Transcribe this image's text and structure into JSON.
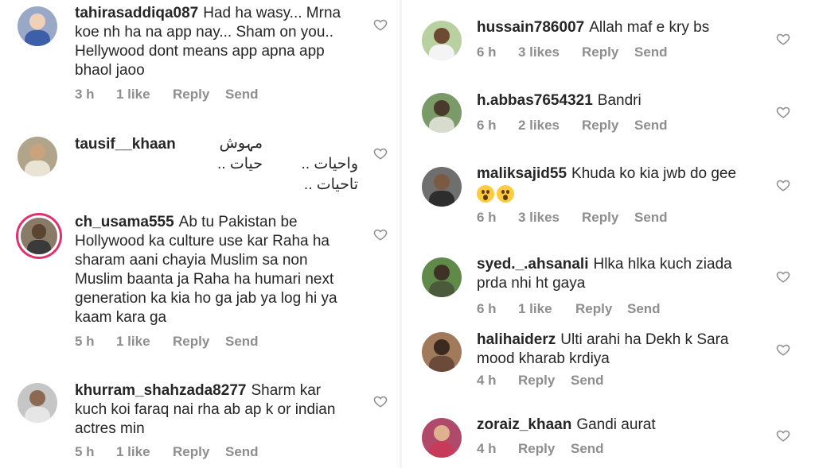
{
  "left": [
    {
      "username": "tahirasaddiqa087",
      "text": "Had ha wasy... Mrna koe nh ha na app nay... Sham on you.. Hellywood dont means app apna app bhaol jaoo",
      "time": "3 h",
      "likes": "1 like",
      "reply": "Reply",
      "send": "Send"
    },
    {
      "username": "tausif__khaan",
      "text_rtl": [
        "مہوش حیات ..",
        "واحیات ..",
        "تاحیات .."
      ]
    },
    {
      "username": "ch_usama555",
      "text": "Ab tu Pakistan be Hollywood ka culture use kar Raha ha sharam aani chayia Muslim sa non Muslim baanta ja Raha ha humari next generation ka kia ho ga jab ya log hi ya kaam kara ga",
      "time": "5 h",
      "likes": "1 like",
      "reply": "Reply",
      "send": "Send"
    },
    {
      "username": "khurram_shahzada8277",
      "text": "Sharm kar kuch koi faraq nai rha ab ap k or indian actres min",
      "time": "5 h",
      "likes": "1 like",
      "reply": "Reply",
      "send": "Send"
    }
  ],
  "right": [
    {
      "username": "hussain786007",
      "text": "Allah maf e kry bs",
      "time": "6 h",
      "likes": "3 likes",
      "reply": "Reply",
      "send": "Send"
    },
    {
      "username": "h.abbas7654321",
      "text": "Bandri",
      "time": "6 h",
      "likes": "2 likes",
      "reply": "Reply",
      "send": "Send"
    },
    {
      "username": "maliksajid55",
      "text": "Khuda ko kia jwb do gee",
      "time": "6 h",
      "likes": "3 likes",
      "reply": "Reply",
      "send": "Send"
    },
    {
      "username": "syed._.ahsanali",
      "text": "Hlka hlka kuch ziada prda nhi ht gaya",
      "time": "6 h",
      "likes": "1 like",
      "reply": "Reply",
      "send": "Send"
    },
    {
      "username": "halihaiderz",
      "text": "Ulti arahi ha Dekh k Sara mood kharab krdiya",
      "time": "4 h",
      "reply": "Reply",
      "send": "Send"
    },
    {
      "username": "zoraiz_khaan",
      "text": "Gandi aurat",
      "time": "4 h",
      "reply": "Reply",
      "send": "Send"
    }
  ],
  "icons": {
    "like": "heart-outline-icon",
    "emoji": "astonished-face-emoji"
  },
  "colors": {
    "text": "#262626",
    "meta": "#8e8e8e",
    "story_ring": "#e1306c"
  }
}
